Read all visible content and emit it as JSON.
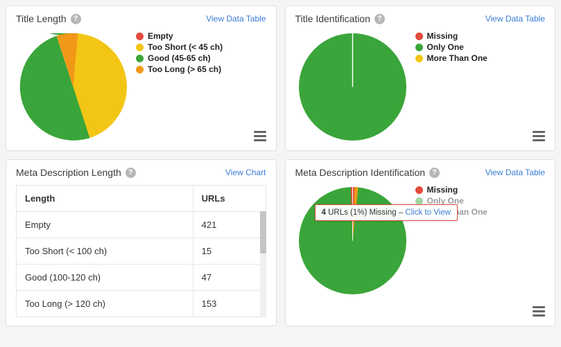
{
  "cards": {
    "title_length": {
      "title": "Title Length",
      "link": "View Data Table",
      "legend": [
        {
          "label": "Empty",
          "color": "#e24a3b"
        },
        {
          "label": "Too Short (< 45 ch)",
          "color": "#f3c515"
        },
        {
          "label": "Good (45-65 ch)",
          "color": "#3aa53a"
        },
        {
          "label": "Too Long (> 65 ch)",
          "color": "#f29818"
        }
      ]
    },
    "title_ident": {
      "title": "Title Identification",
      "link": "View Data Table",
      "legend": [
        {
          "label": "Missing",
          "color": "#e24a3b"
        },
        {
          "label": "Only One",
          "color": "#3aa53a"
        },
        {
          "label": "More Than One",
          "color": "#f3c515"
        }
      ]
    },
    "meta_len": {
      "title": "Meta Description Length",
      "link": "View Chart",
      "table_headers": {
        "c1": "Length",
        "c2": "URLs"
      },
      "rows": [
        {
          "label": "Empty",
          "value": "421"
        },
        {
          "label": "Too Short (< 100 ch)",
          "value": "15"
        },
        {
          "label": "Good (100-120 ch)",
          "value": "47"
        },
        {
          "label": "Too Long (> 120 ch)",
          "value": "153"
        }
      ]
    },
    "meta_ident": {
      "title": "Meta Description Identification",
      "link": "View Data Table",
      "legend": [
        {
          "label": "Missing",
          "color": "#e24a3b"
        },
        {
          "label": "Only One",
          "color": "#3aa53a"
        },
        {
          "label": "More Than One",
          "color": "#f3c515"
        }
      ],
      "tooltip": {
        "count": "4",
        "text": " URLs (1%) Missing – ",
        "link": "Click to View"
      }
    }
  },
  "chart_data": [
    {
      "type": "pie",
      "title": "Title Length",
      "series": [
        {
          "name": "Empty",
          "value": 0,
          "color": "#e24a3b"
        },
        {
          "name": "Too Short (< 45 ch)",
          "value": 45,
          "color": "#f3c515"
        },
        {
          "name": "Good (45-65 ch)",
          "value": 50,
          "color": "#3aa53a"
        },
        {
          "name": "Too Long (> 65 ch)",
          "value": 5,
          "color": "#f29818"
        }
      ]
    },
    {
      "type": "pie",
      "title": "Title Identification",
      "series": [
        {
          "name": "Missing",
          "value": 0,
          "color": "#e24a3b"
        },
        {
          "name": "Only One",
          "value": 100,
          "color": "#3aa53a"
        },
        {
          "name": "More Than One",
          "value": 0,
          "color": "#f3c515"
        }
      ]
    },
    {
      "type": "table",
      "title": "Meta Description Length",
      "categories": [
        "Empty",
        "Too Short (< 100 ch)",
        "Good (100-120 ch)",
        "Too Long (> 120 ch)"
      ],
      "values": [
        421,
        15,
        47,
        153
      ]
    },
    {
      "type": "pie",
      "title": "Meta Description Identification",
      "series": [
        {
          "name": "Missing",
          "value": 1,
          "color": "#e24a3b"
        },
        {
          "name": "Only One",
          "value": 98,
          "color": "#3aa53a"
        },
        {
          "name": "More Than One",
          "value": 1,
          "color": "#f3c515"
        }
      ]
    }
  ]
}
